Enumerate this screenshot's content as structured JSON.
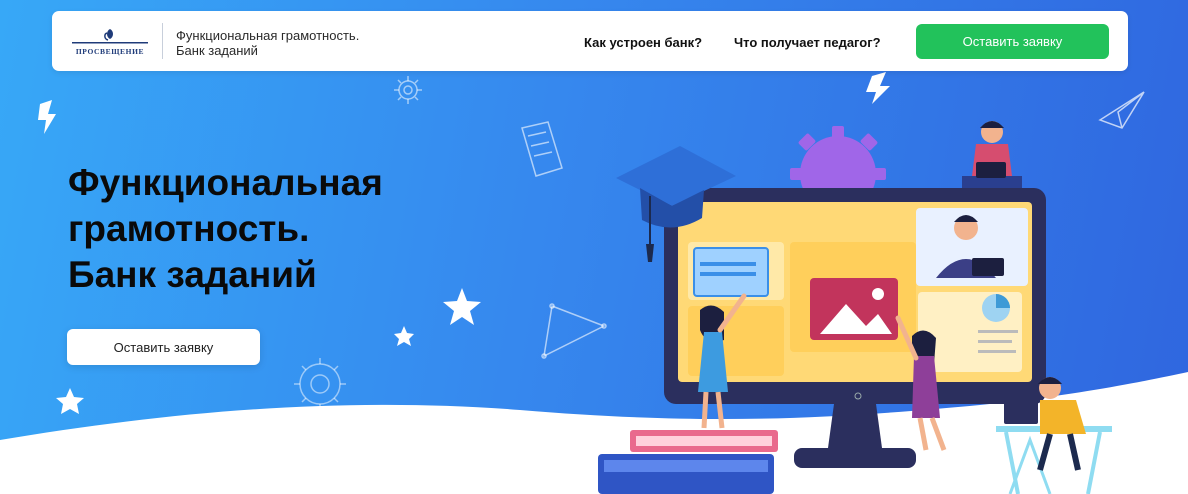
{
  "header": {
    "logo_text": "ПРОСВЕЩЕНИЕ",
    "brand_line1": "Функциональная грамотность.",
    "brand_line2": "Банк заданий",
    "nav": [
      {
        "label": "Как устроен банк?"
      },
      {
        "label": "Что получает педагог?"
      }
    ],
    "cta_label": "Оставить заявку"
  },
  "hero": {
    "title_lines": [
      "Функциональная",
      "грамотность.",
      "Банк заданий"
    ],
    "cta_label": "Оставить заявку"
  },
  "colors": {
    "bg_start": "#37a8f7",
    "bg_end": "#2f66df",
    "cta_green": "#22c25b",
    "monitor": "#2b2f5e",
    "screen": "#ffd976"
  },
  "illustration": {
    "icons": [
      "gear-icon",
      "lightning-icon",
      "paper-plane-icon",
      "book-icon",
      "star-icon",
      "triangle-icon",
      "graduation-cap-icon",
      "image-icon",
      "pie-chart-icon"
    ]
  }
}
